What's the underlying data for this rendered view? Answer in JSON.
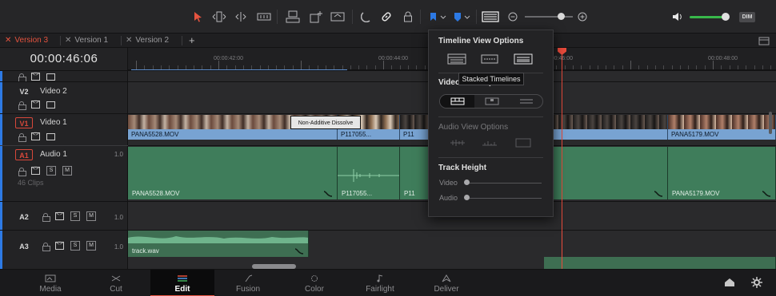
{
  "toolbar": {
    "tools": [
      "select-tool",
      "trim-tool",
      "dynamic-trim-tool",
      "blade-tool",
      "insert-clip",
      "overwrite-clip",
      "replace-clip",
      "snapping",
      "linked-selection",
      "position-lock",
      "flag",
      "marker",
      "timeline-view-options",
      "zoom-out",
      "zoom-in",
      "volume"
    ],
    "dim_label": "DIM",
    "zoom_level": 0.7,
    "volume_level": 0.85
  },
  "tabs": [
    {
      "label": "Version 3",
      "active": true
    },
    {
      "label": "Version 1",
      "active": false
    },
    {
      "label": "Version 2",
      "active": false
    }
  ],
  "timecode": "00:00:46:06",
  "ruler": {
    "labels": [
      "00:00:42:00",
      "00:00:44:00",
      "00:00:46:00",
      "00:00:48:00"
    ]
  },
  "tracks": {
    "v2": {
      "id": "V2",
      "name": "Video 2"
    },
    "v1": {
      "id": "V1",
      "name": "Video 1"
    },
    "a1": {
      "id": "A1",
      "name": "Audio 1",
      "level": "1.0",
      "clips": "46 Clips"
    },
    "a2": {
      "id": "A2",
      "level": "1.0"
    },
    "a3": {
      "id": "A3",
      "level": "1.0"
    },
    "solo_label": "S",
    "mute_label": "M"
  },
  "video_clips": [
    "PANA5528.MOV",
    "P117055...",
    "P11",
    "PANA5179.MOV"
  ],
  "audio_clips": [
    "PANA5528.MOV",
    "P117055...",
    "P11",
    "PANA5179.MOV"
  ],
  "a3_clip": "track.wav",
  "transition": "Non-Additive Dissolve",
  "popover": {
    "title": "Timeline View Options",
    "video_view": "Video View Options",
    "audio_view": "Audio View Options",
    "track_height": "Track Height",
    "video_label": "Video",
    "audio_label": "Audio",
    "video_height": 0,
    "audio_height": 0,
    "tooltip": "Stacked Timelines"
  },
  "pages": [
    {
      "label": "Media",
      "icon": "media-icon"
    },
    {
      "label": "Cut",
      "icon": "cut-icon"
    },
    {
      "label": "Edit",
      "icon": "edit-icon",
      "active": true
    },
    {
      "label": "Fusion",
      "icon": "fusion-icon"
    },
    {
      "label": "Color",
      "icon": "color-icon"
    },
    {
      "label": "Fairlight",
      "icon": "fairlight-icon"
    },
    {
      "label": "Deliver",
      "icon": "deliver-icon"
    }
  ],
  "colors": {
    "accent": "#e5533f",
    "video_clip": "#5c85b4",
    "audio_clip": "#3f7d5b",
    "playhead": "#ea4b3b"
  }
}
